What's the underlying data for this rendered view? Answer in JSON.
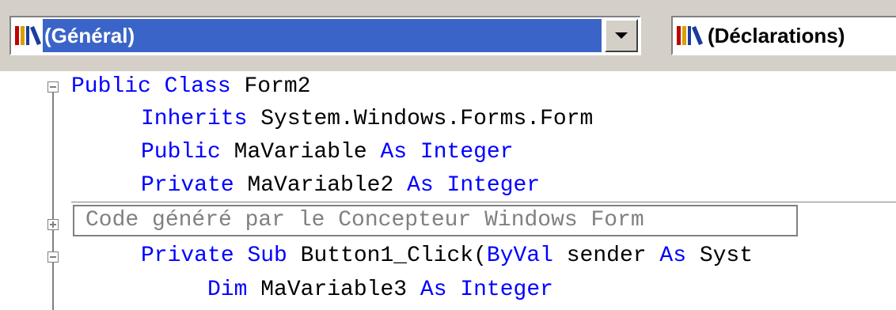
{
  "object_combo": {
    "selected": "(Général)",
    "icon": "library-icon"
  },
  "procedure_combo": {
    "selected": "(Déclarations)",
    "icon": "library-icon"
  },
  "code": {
    "line1": {
      "kw1": "Public",
      "kw2": "Class",
      "name": "Form2"
    },
    "line2": {
      "kw": "Inherits",
      "rest": "System.Windows.Forms.Form"
    },
    "line3": {
      "kw1": "Public",
      "name": "MaVariable",
      "kw2": "As",
      "kw3": "Integer"
    },
    "line4": {
      "kw1": "Private",
      "name": "MaVariable2",
      "kw2": "As",
      "kw3": "Integer"
    },
    "region_label": "Code généré par le Concepteur Windows Form",
    "line6": {
      "kw1": "Private",
      "kw2": "Sub",
      "name": "Button1_Click(",
      "kw3": "ByVal",
      "param": "sender",
      "kw4": "As",
      "rest": "Syst"
    },
    "line7": {
      "kw1": "Dim",
      "name": "MaVariable3",
      "kw2": "As",
      "kw3": "Integer"
    }
  },
  "colors": {
    "keyword": "#0000ff",
    "plain": "#000000",
    "collapsed": "#808080",
    "selection": "#3a64c8"
  }
}
